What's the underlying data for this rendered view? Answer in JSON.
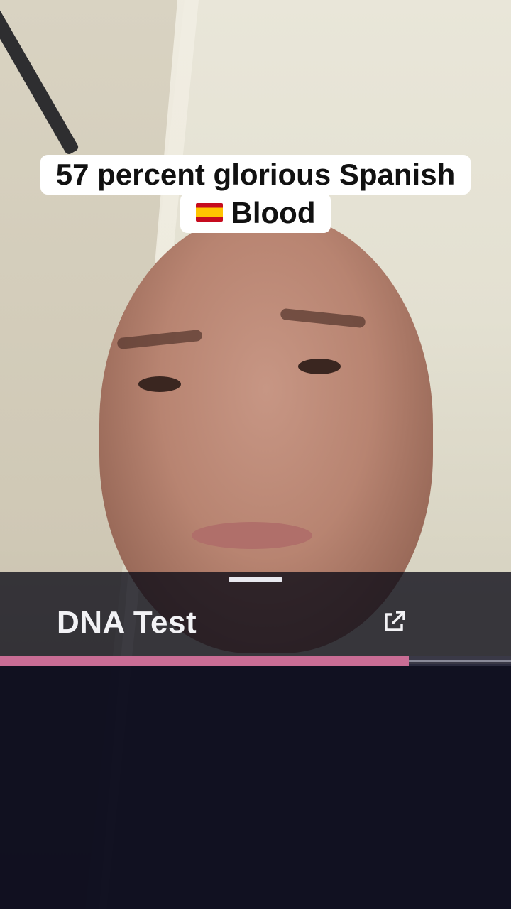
{
  "caption": {
    "line1": "57 percent glorious Spanish",
    "line2": "Blood",
    "flag_icon": "spain-flag-icon"
  },
  "sheet": {
    "title": "DNA Test",
    "open_icon": "external-link-icon",
    "progress_fraction": 0.8,
    "accent_color": "#c96d95"
  }
}
